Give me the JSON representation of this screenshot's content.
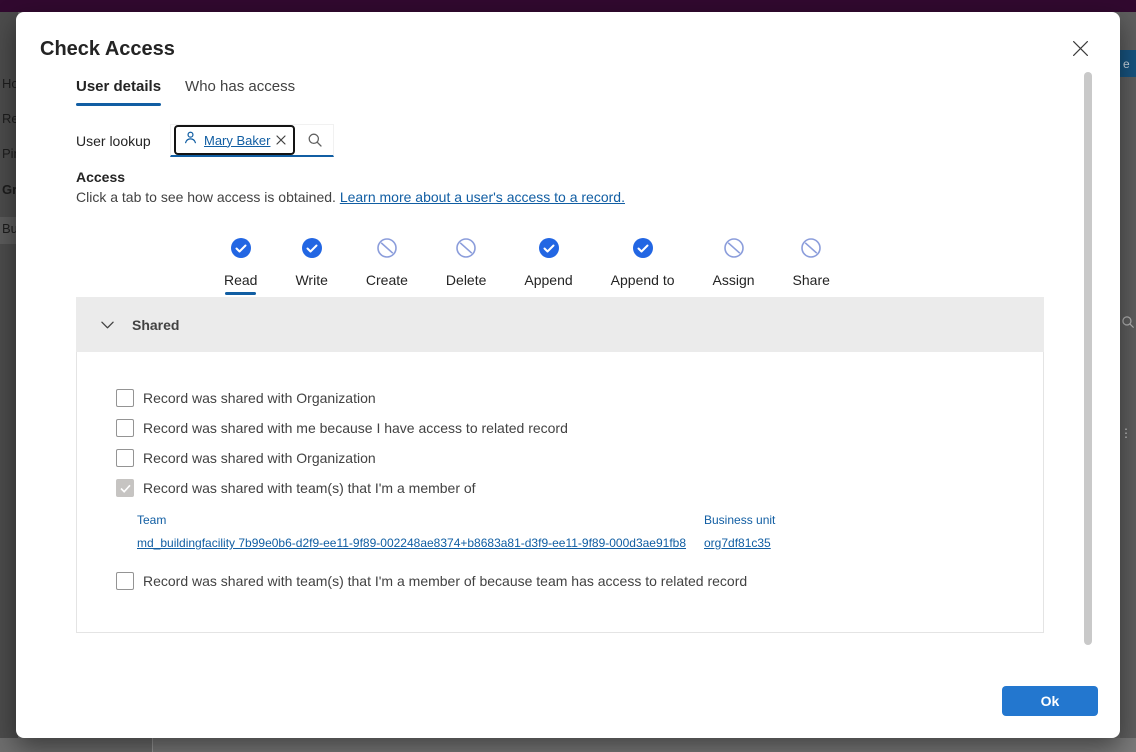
{
  "backdrop": {
    "sidebar_fragments": [
      "Ho",
      "Re",
      "Pin",
      "Gr",
      "Bu"
    ],
    "right_button_text": "e"
  },
  "dialog": {
    "title": "Check Access",
    "tabs": [
      {
        "label": "User details",
        "active": true
      },
      {
        "label": "Who has access",
        "active": false
      }
    ],
    "lookup": {
      "label": "User lookup",
      "chip": {
        "icon": "person-icon",
        "name": "Mary Baker",
        "remove_icon": "close-icon"
      },
      "search_icon": "search-icon"
    },
    "access": {
      "heading": "Access",
      "description": "Click a tab to see how access is obtained. ",
      "link_text": "Learn more about a user's access to a record."
    },
    "permissions": [
      {
        "label": "Read",
        "state": "allowed",
        "selected": true
      },
      {
        "label": "Write",
        "state": "allowed",
        "selected": false
      },
      {
        "label": "Create",
        "state": "denied",
        "selected": false
      },
      {
        "label": "Delete",
        "state": "denied",
        "selected": false
      },
      {
        "label": "Append",
        "state": "allowed",
        "selected": false
      },
      {
        "label": "Append to",
        "state": "allowed",
        "selected": false
      },
      {
        "label": "Assign",
        "state": "denied",
        "selected": false
      },
      {
        "label": "Share",
        "state": "denied",
        "selected": false
      }
    ],
    "shared": {
      "title": "Shared",
      "checkboxes": [
        {
          "label": "Record was shared with Organization",
          "checked": false
        },
        {
          "label": "Record was shared with me because I have access to related record",
          "checked": false
        },
        {
          "label": "Record was shared with Organization",
          "checked": false
        },
        {
          "label": "Record was shared with team(s) that I'm a member of",
          "checked": true
        },
        {
          "label": "Record was shared with team(s) that I'm a member of because team has access to related record",
          "checked": false
        }
      ],
      "table": {
        "columns": [
          "Team",
          "Business unit"
        ],
        "rows": [
          [
            "md_buildingfacility 7b99e0b6-d2f9-ee11-9f89-002248ae8374+b8683a81-d3f9-ee11-9f89-000d3ae91fb8",
            "org7df81c35"
          ]
        ]
      }
    },
    "ok_label": "Ok"
  },
  "colors": {
    "accent_blue": "#115ea3",
    "allowed_icon": "#2266e3",
    "denied_icon": "#8b9ddb",
    "ok_button": "#2377cf",
    "topbar_purple": "#31092f",
    "shared_header_bg": "#ebebeb",
    "checked_checkbox": "#c6c4c2"
  }
}
